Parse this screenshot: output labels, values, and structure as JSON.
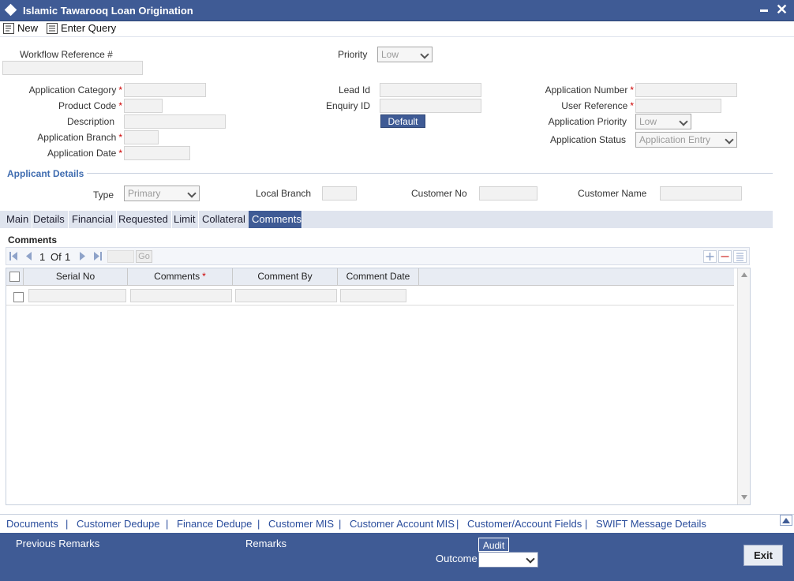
{
  "window": {
    "title": "Islamic Tawarooq Loan Origination"
  },
  "toolbar": {
    "new_label": "New",
    "enter_query_label": "Enter Query"
  },
  "header": {
    "workflow_reference_label": "Workflow Reference #",
    "priority_label": "Priority",
    "priority_value": "Low"
  },
  "form": {
    "application_category_label": "Application Category",
    "product_code_label": "Product Code",
    "description_label": "Description",
    "application_branch_label": "Application Branch",
    "application_date_label": "Application Date",
    "lead_id_label": "Lead Id",
    "enquiry_id_label": "Enquiry ID",
    "default_button": "Default",
    "application_number_label": "Application Number",
    "user_reference_label": "User Reference",
    "application_priority_label": "Application Priority",
    "application_priority_value": "Low",
    "application_status_label": "Application Status",
    "application_status_value": "Application Entry",
    "required_mark": "*"
  },
  "applicant": {
    "section_title": "Applicant Details",
    "type_label": "Type",
    "type_value": "Primary",
    "local_branch_label": "Local Branch",
    "customer_no_label": "Customer No",
    "customer_name_label": "Customer Name"
  },
  "tabs": [
    {
      "label": "Main"
    },
    {
      "label": "Details"
    },
    {
      "label": "Financial"
    },
    {
      "label": "Requested"
    },
    {
      "label": "Limit"
    },
    {
      "label": "Collateral"
    },
    {
      "label": "Comments"
    }
  ],
  "comments": {
    "section_title": "Comments",
    "page_current": "1",
    "page_of": "Of",
    "page_total": "1",
    "go_label": "Go",
    "columns": [
      "Serial No",
      "Comments",
      "Comment By",
      "Comment Date"
    ],
    "required_mark": "*"
  },
  "links": [
    "Documents",
    "Customer Dedupe",
    "Finance Dedupe",
    "Customer MIS",
    "Customer Account MIS",
    "Customer/Account Fields",
    "SWIFT Message Details"
  ],
  "link_separator": "|",
  "footer": {
    "previous_remarks_label": "Previous Remarks",
    "remarks_label": "Remarks",
    "audit_label": "Audit",
    "outcome_label": "Outcome",
    "exit_label": "Exit"
  },
  "colors": {
    "brand": "#3f5b95",
    "required": "#cc0000",
    "link": "#2a4d9c"
  }
}
